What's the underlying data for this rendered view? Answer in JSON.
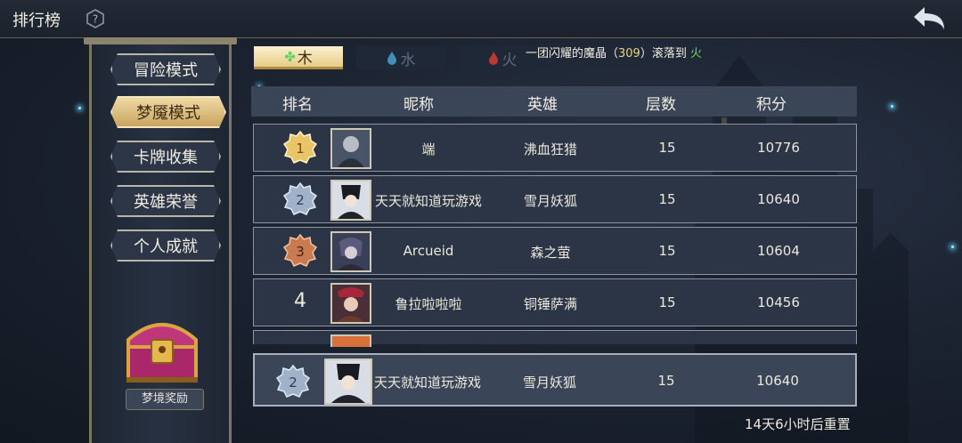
{
  "header": {
    "title": "排行榜"
  },
  "sidebar": {
    "items": [
      {
        "label": "冒险模式"
      },
      {
        "label": "梦魇模式"
      },
      {
        "label": "卡牌收集"
      },
      {
        "label": "英雄荣誉"
      },
      {
        "label": "个人成就"
      }
    ],
    "active_index": 1,
    "reward_label": "梦境奖励"
  },
  "tabs": [
    {
      "label": "木",
      "icon": "leaf-icon",
      "color": "#5fcf62"
    },
    {
      "label": "水",
      "icon": "water-drop-icon",
      "color": "#3f8fb8"
    },
    {
      "label": "火",
      "icon": "fire-icon",
      "color": "#b83a32"
    }
  ],
  "notice": {
    "prefix": "一团闪耀的魔晶（",
    "count": "309",
    "middle": "）滚落到",
    "element": "火"
  },
  "table": {
    "columns": [
      "排名",
      "昵称",
      "英雄",
      "层数",
      "积分"
    ],
    "rows": [
      {
        "rank": "1",
        "name": "端",
        "hero": "沸血狂猎",
        "floors": "15",
        "score": "10776"
      },
      {
        "rank": "2",
        "name": "天天就知道玩游戏",
        "hero": "雪月妖狐",
        "floors": "15",
        "score": "10640"
      },
      {
        "rank": "3",
        "name": "Arcueid",
        "hero": "森之萤",
        "floors": "15",
        "score": "10604"
      },
      {
        "rank": "4",
        "name": "鲁拉啦啦啦",
        "hero": "铜锤萨满",
        "floors": "15",
        "score": "10456"
      }
    ],
    "my_row": {
      "rank": "2",
      "name": "天天就知道玩游戏",
      "hero": "雪月妖狐",
      "floors": "15",
      "score": "10640"
    }
  },
  "footer": {
    "reset_text": "14天6小时后重置"
  }
}
